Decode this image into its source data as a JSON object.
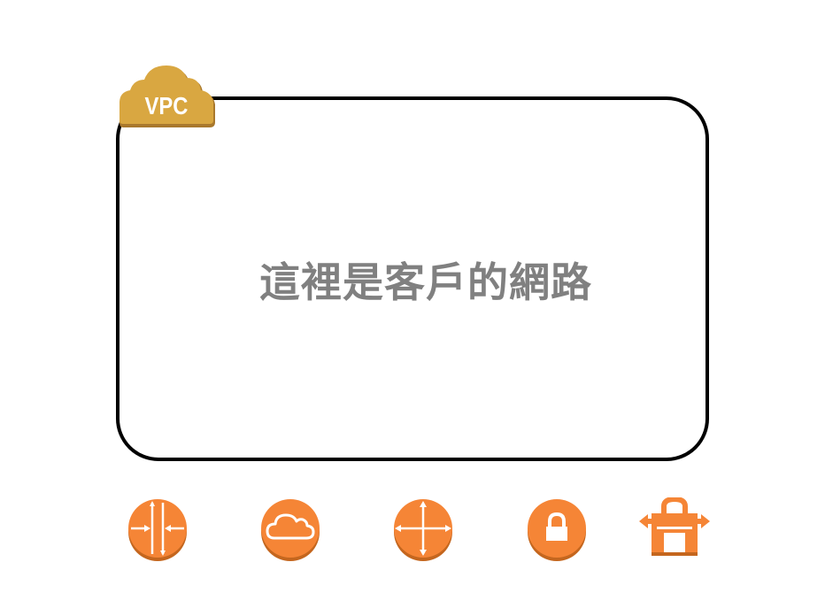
{
  "vpc": {
    "badge_label": "VPC",
    "description": "這裡是客戶的網路"
  },
  "icons": [
    {
      "name": "router-icon"
    },
    {
      "name": "cloud-icon"
    },
    {
      "name": "router-icon"
    },
    {
      "name": "lock-icon"
    },
    {
      "name": "gateway-icon"
    }
  ],
  "colors": {
    "badge": "#D9A741",
    "badge_shadow": "#A9782C",
    "icon_fill": "#F58536",
    "icon_shadow": "#C4661E",
    "border": "#000000",
    "text": "#808080"
  }
}
